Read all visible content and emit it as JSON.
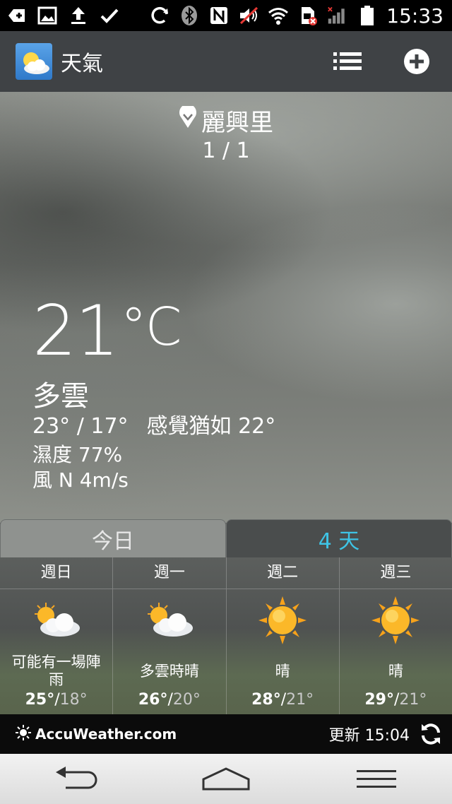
{
  "status_bar": {
    "time": "15:33",
    "left_icons": [
      "add-box-icon",
      "image-icon",
      "upload-icon",
      "check-icon"
    ],
    "right_icons": [
      "sync-icon",
      "bluetooth-icon",
      "nfc-icon",
      "mute-icon",
      "wifi-icon",
      "sim-error-icon",
      "signal-icon",
      "battery-icon"
    ]
  },
  "app_bar": {
    "title": "天氣",
    "icons": [
      "weather-logo-icon",
      "list-icon",
      "add-circle-icon"
    ]
  },
  "current": {
    "location": "麗興里",
    "page_indicator": "1 / 1",
    "temperature": "21",
    "unit": "°C",
    "condition": "多雲",
    "high_low": "23° / 17°",
    "feels_like": "感覺猶如 22°",
    "humidity": "濕度 77%",
    "wind": "風 N 4m/s"
  },
  "tabs": [
    {
      "label": "今日",
      "selected": false
    },
    {
      "label": "4 天",
      "selected": true
    }
  ],
  "forecast": [
    {
      "day": "週日",
      "icon": "partly-cloudy-icon",
      "condition": "可能有一場陣雨",
      "high": "25°",
      "low": "18°"
    },
    {
      "day": "週一",
      "icon": "partly-cloudy-icon",
      "condition": "多雲時晴",
      "high": "26°",
      "low": "20°"
    },
    {
      "day": "週二",
      "icon": "sunny-icon",
      "condition": "晴",
      "high": "28°",
      "low": "21°"
    },
    {
      "day": "週三",
      "icon": "sunny-icon",
      "condition": "晴",
      "high": "29°",
      "low": "21°"
    }
  ],
  "footer": {
    "brand": "AccuWeather.com",
    "updated": "更新 15:04"
  },
  "colors": {
    "selected_tab_text": "#3ec4e6",
    "app_bar": "#3f4245",
    "footer": "#0b0b0b"
  }
}
